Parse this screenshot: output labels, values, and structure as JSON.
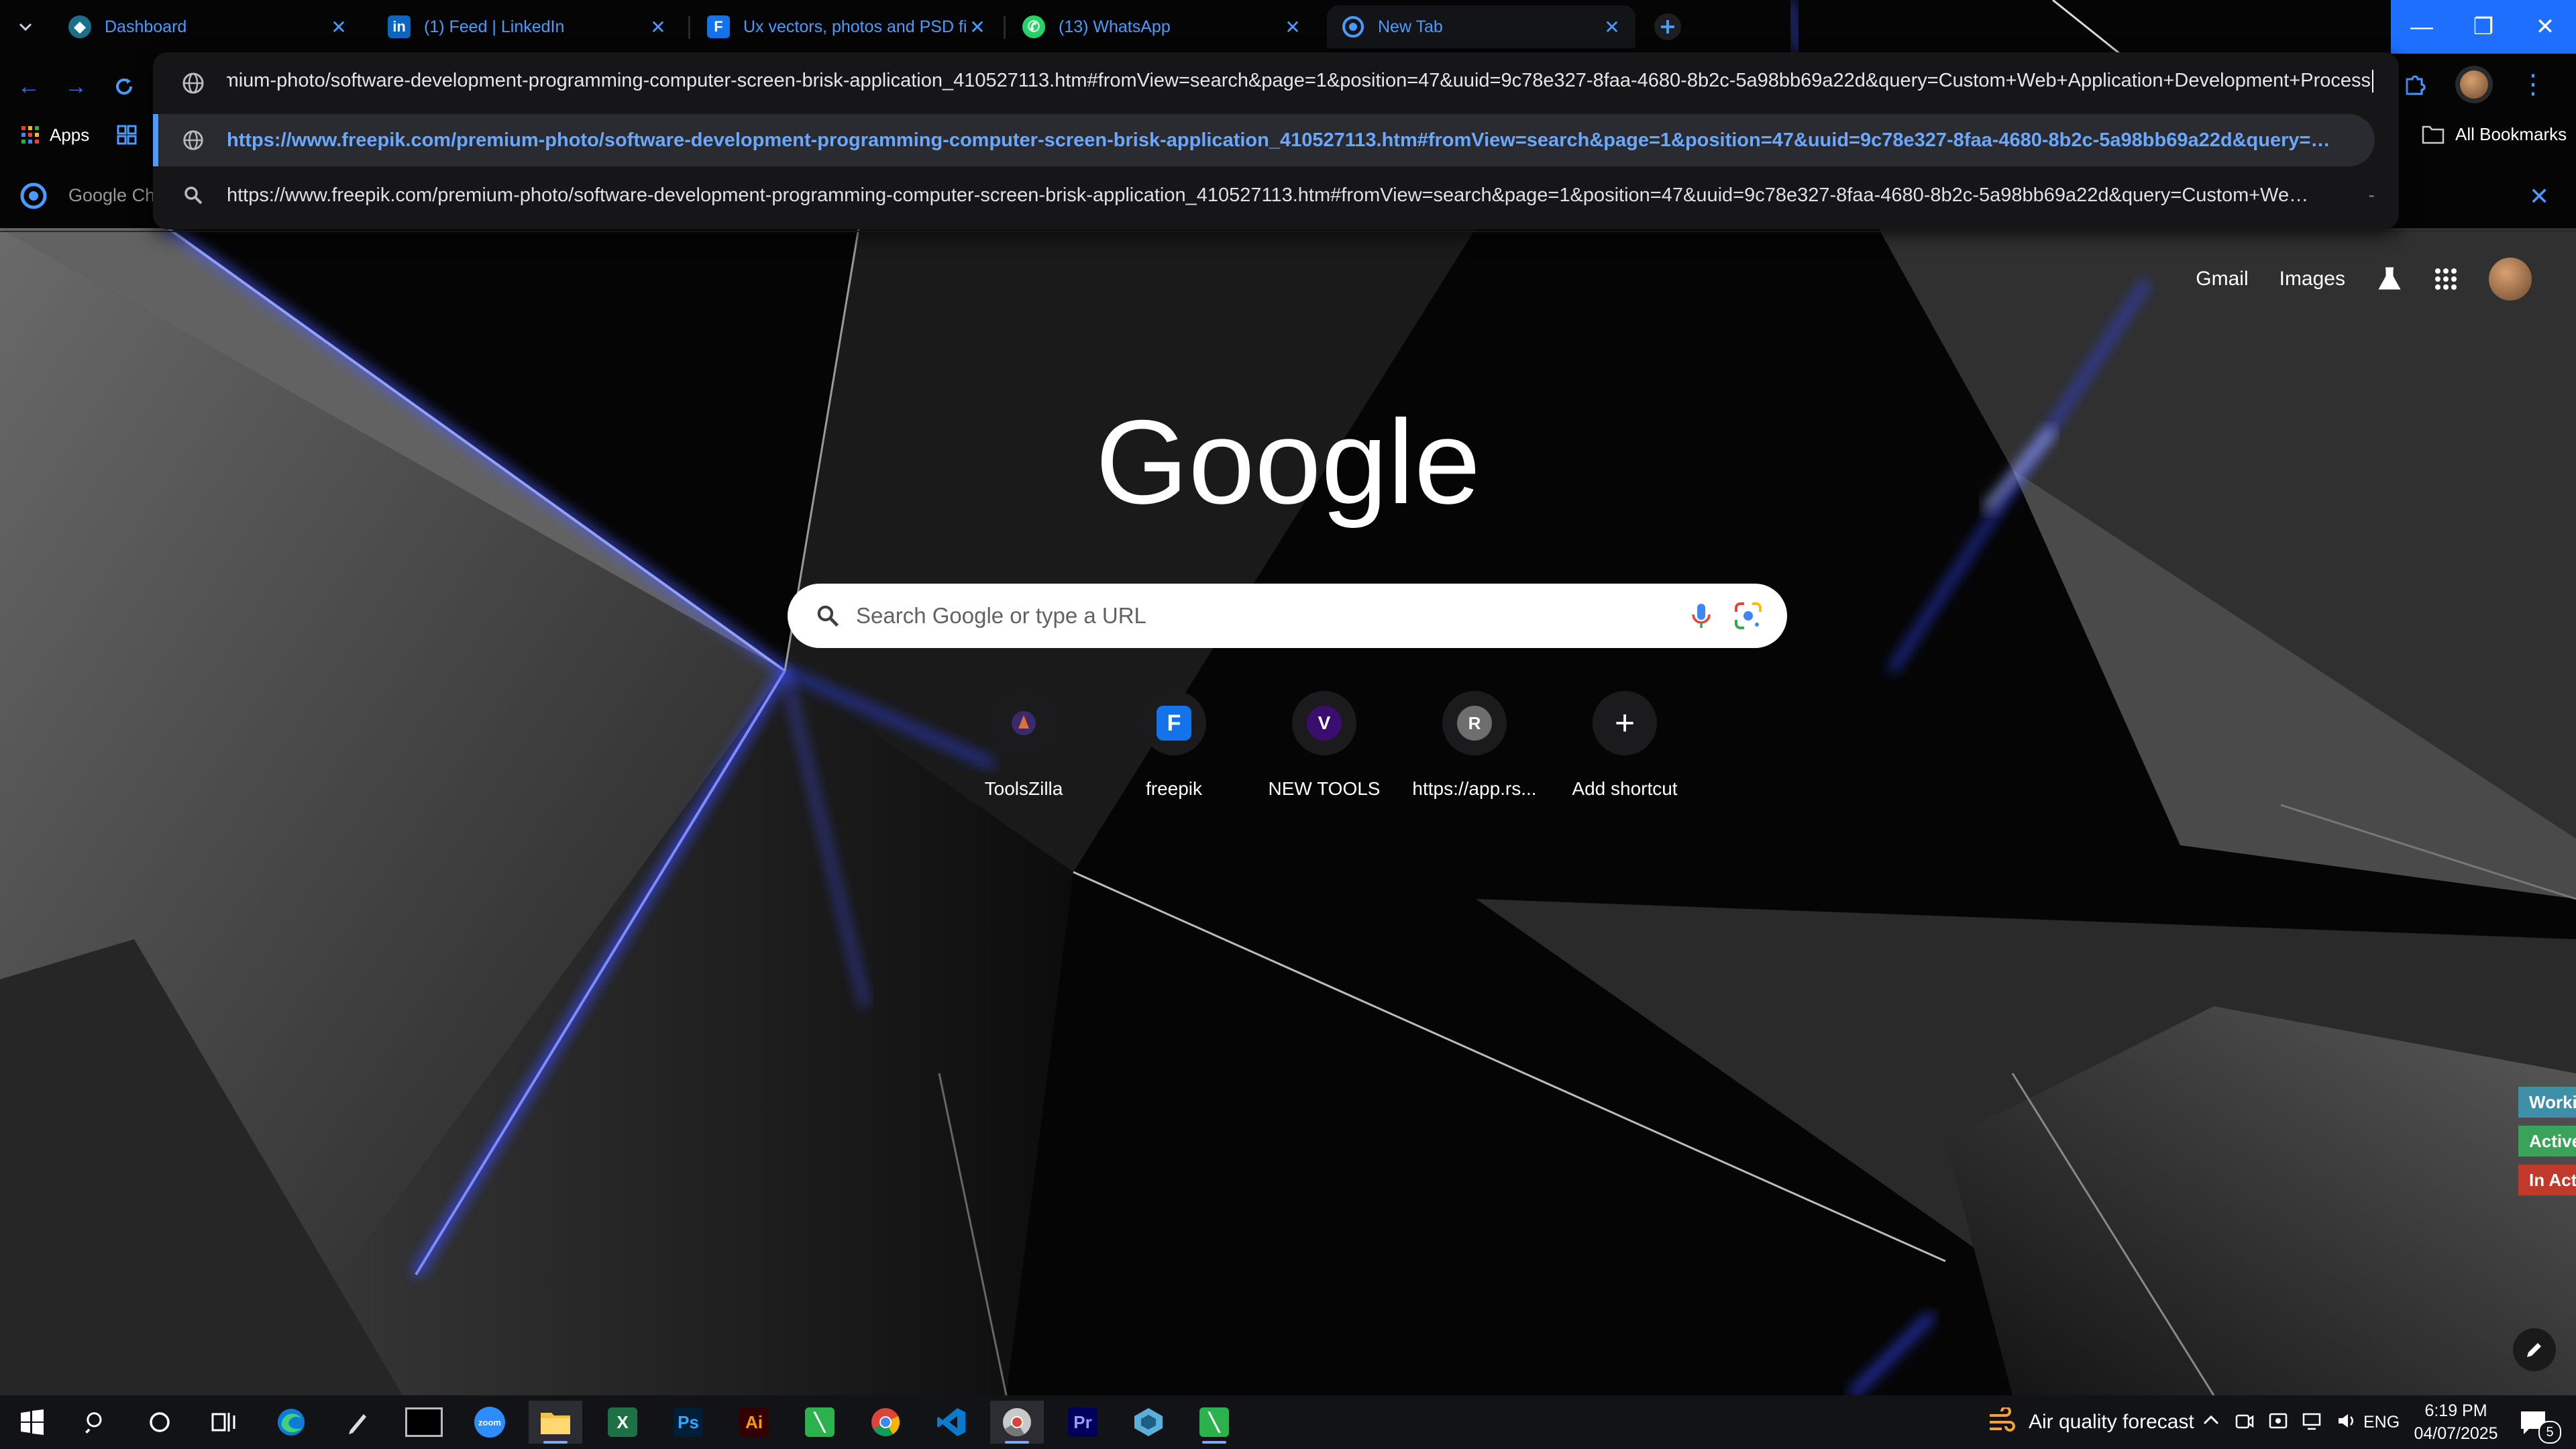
{
  "tabs": [
    {
      "title": "Dashboard",
      "icon": "dashboard-favicon"
    },
    {
      "title": "(1) Feed | LinkedIn",
      "icon": "linkedin-favicon"
    },
    {
      "title": "Ux vectors, photos and PSD files",
      "icon": "freepik-favicon"
    },
    {
      "title": "(13) WhatsApp",
      "icon": "whatsapp-favicon"
    },
    {
      "title": "New Tab",
      "icon": "chrome-favicon"
    }
  ],
  "bookmarks_bar": {
    "apps_label": "Apps",
    "all_bookmarks_label": "All Bookmarks"
  },
  "omnibox": {
    "input_value": "remium-photo/software-development-programming-computer-screen-brisk-application_410527113.htm#fromView=search&page=1&position=47&uuid=9c78e327-8faa-4680-8b2c-5a98bb69a22d&query=Custom+Web+Application+Development+Process",
    "suggestions": [
      {
        "text": "https://www.freepik.com/premium-photo/software-development-programming-computer-screen-brisk-application_410527113.htm#fromView=search&page=1&position=47&uuid=9c78e327-8faa-4680-8b2c-5a98bb69a22d&query=Custo...",
        "icon": "globe-icon"
      },
      {
        "text": "https://www.freepik.com/premium-photo/software-development-programming-computer-screen-brisk-application_410527113.htm#fromView=search&page=1&position=47&uuid=9c78e327-8faa-4680-8b2c-5a98bb69a22d&query=Custom+Web+Applicat...",
        "suffix": "-",
        "icon": "search-icon"
      }
    ]
  },
  "infobar": {
    "text": "Google Ch"
  },
  "ntp": {
    "gmail": "Gmail",
    "images": "Images",
    "logo_text": "Google",
    "search_placeholder": "Search Google or type a URL",
    "shortcuts": [
      {
        "label": "ToolsZilla",
        "letter": ""
      },
      {
        "label": "freepik",
        "letter": ""
      },
      {
        "label": "NEW TOOLS",
        "letter": "V"
      },
      {
        "label": "https://app.rs...",
        "letter": "R"
      },
      {
        "label": "Add shortcut",
        "letter": "+"
      }
    ]
  },
  "side_tags": [
    {
      "text": "Worki",
      "color": "#3f8fa8"
    },
    {
      "text": "Active",
      "color": "#3aa35a"
    },
    {
      "text": "In Acti",
      "color": "#c0392b"
    }
  ],
  "taskbar": {
    "weather_label": "Air quality forecast",
    "language": "ENG",
    "time": "6:19 PM",
    "date": "04/07/2025",
    "notification_count": "5",
    "apps": [
      {
        "name": "start",
        "label": ""
      },
      {
        "name": "search",
        "label": ""
      },
      {
        "name": "cortana",
        "label": ""
      },
      {
        "name": "task-view",
        "label": ""
      },
      {
        "name": "edge",
        "label": ""
      },
      {
        "name": "pen",
        "label": ""
      },
      {
        "name": "terminal",
        "label": ""
      },
      {
        "name": "zoom",
        "label": "zoom"
      },
      {
        "name": "file-explorer",
        "label": ""
      },
      {
        "name": "excel",
        "label": "X"
      },
      {
        "name": "photoshop",
        "label": "Ps"
      },
      {
        "name": "illustrator",
        "label": "Ai"
      },
      {
        "name": "app-green",
        "label": ""
      },
      {
        "name": "chrome",
        "label": ""
      },
      {
        "name": "vscode",
        "label": ""
      },
      {
        "name": "chrome-dev",
        "label": ""
      },
      {
        "name": "premiere",
        "label": "Pr"
      },
      {
        "name": "app-blue",
        "label": ""
      },
      {
        "name": "app-green-2",
        "label": ""
      }
    ]
  }
}
